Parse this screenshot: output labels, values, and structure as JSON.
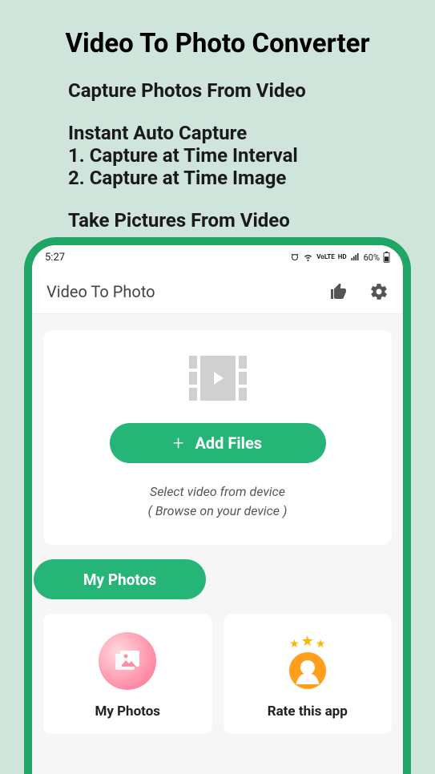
{
  "header": {
    "title": "Video To Photo Converter",
    "subtitle1": "Capture Photos From Video",
    "feature_heading": "Instant Auto Capture",
    "feature_1": "1. Capture at Time Interval",
    "feature_2": "2. Capture at Time Image",
    "subtitle2": "Take Pictures From Video"
  },
  "statusbar": {
    "time": "5:27",
    "battery": "60%",
    "indicators": "⏰ 📶 ᵛᵒᴸᵀᴱ ᴴᴰ 📶"
  },
  "appbar": {
    "title": "Video To Photo"
  },
  "upload": {
    "button_label": "Add Files",
    "hint_line1": "Select video from device",
    "hint_line2": "( Browse on your device )"
  },
  "tabs": {
    "my_photos": "My Photos"
  },
  "cards": {
    "my_photos": "My Photos",
    "rate_app": "Rate this app"
  }
}
